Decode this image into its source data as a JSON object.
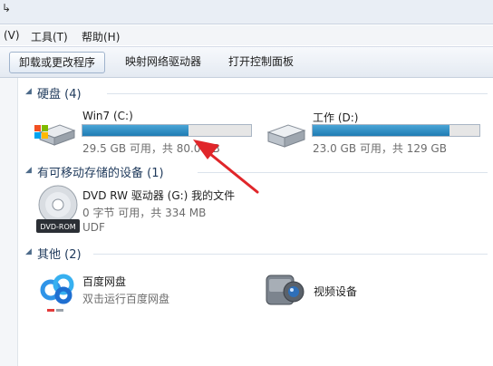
{
  "window": {
    "back_glyph": "↳"
  },
  "menu": {
    "view": "(V)",
    "tools": "工具(T)",
    "help": "帮助(H)"
  },
  "toolbar": {
    "uninstall": "卸载或更改程序",
    "map_drive": "映射网络驱动器",
    "control_panel": "打开控制面板"
  },
  "sections": {
    "hard_disks": "硬盘 (4)",
    "removable": "有可移动存储的设备 (1)",
    "other": "其他 (2)"
  },
  "drives": [
    {
      "name": "Win7 (C:)",
      "free_text": "29.5 GB 可用，共 80.0 GB",
      "used_fraction": 0.63
    },
    {
      "name": "工作 (D:)",
      "free_text": "23.0 GB 可用，共 129 GB",
      "used_fraction": 0.82
    }
  ],
  "dvd": {
    "name": "DVD RW 驱动器 (G:) 我的文件",
    "free_text": "0 字节 可用，共 334 MB",
    "fs": "UDF",
    "icon_label": "DVD-ROM"
  },
  "others": [
    {
      "name": "百度网盘",
      "desc": "双击运行百度网盘"
    },
    {
      "name": "视频设备",
      "desc": ""
    }
  ],
  "colors": {
    "bar_fill": "#2a8cc4",
    "section_title": "#1e395b",
    "annotation_arrow": "#e0262a"
  }
}
